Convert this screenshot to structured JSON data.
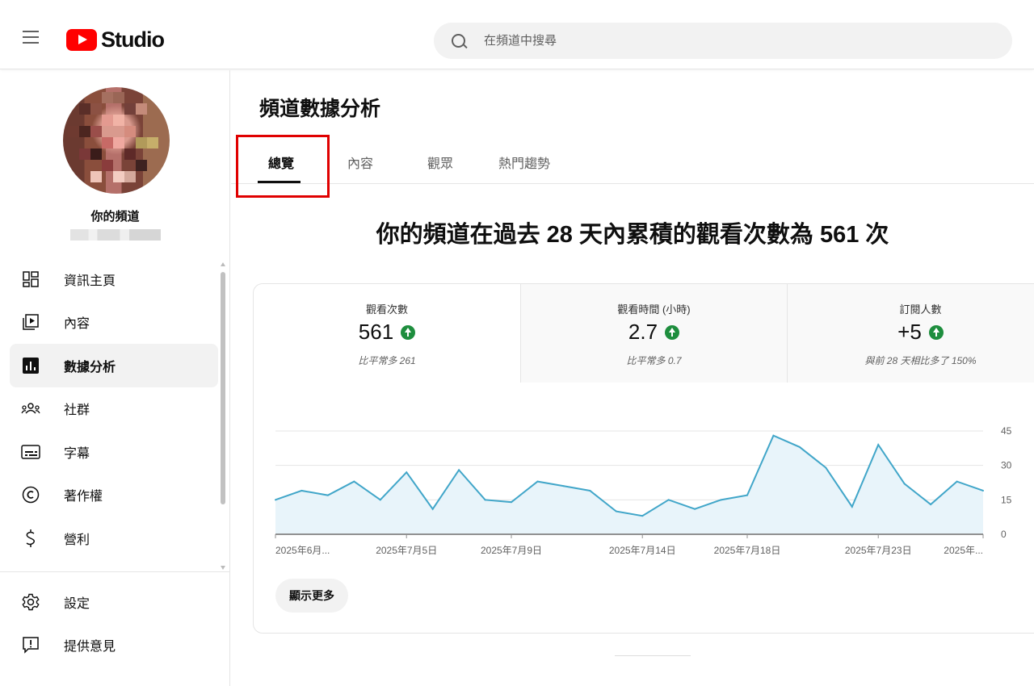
{
  "header": {
    "logo_text": "Studio",
    "search_placeholder": "在頻道中搜尋"
  },
  "sidebar": {
    "channel_name": "你的頻道",
    "items": [
      {
        "label": "資訊主頁",
        "icon": "dashboard-icon"
      },
      {
        "label": "內容",
        "icon": "content-icon"
      },
      {
        "label": "數據分析",
        "icon": "analytics-icon",
        "active": true
      },
      {
        "label": "社群",
        "icon": "community-icon"
      },
      {
        "label": "字幕",
        "icon": "subtitles-icon"
      },
      {
        "label": "著作權",
        "icon": "copyright-icon"
      },
      {
        "label": "營利",
        "icon": "earn-icon"
      }
    ],
    "bottom_items": [
      {
        "label": "設定",
        "icon": "settings-icon"
      },
      {
        "label": "提供意見",
        "icon": "feedback-icon"
      }
    ]
  },
  "main": {
    "title": "頻道數據分析",
    "tabs": [
      {
        "label": "總覽",
        "active": true
      },
      {
        "label": "內容"
      },
      {
        "label": "觀眾"
      },
      {
        "label": "熱門趨勢"
      }
    ],
    "headline": "你的頻道在過去 28 天內累積的觀看次數為 561 次",
    "metrics": [
      {
        "label": "觀看次數",
        "value": "561",
        "sub": "比平常多 261",
        "trend": "up"
      },
      {
        "label": "觀看時間 (小時)",
        "value": "2.7",
        "sub": "比平常多 0.7",
        "trend": "up"
      },
      {
        "label": "訂閱人數",
        "value": "+5",
        "sub": "與前 28 天相比多了 150%",
        "trend": "up"
      }
    ],
    "show_more_label": "顯示更多"
  },
  "colors": {
    "accent_red": "#ff0000",
    "line": "#41a6c9",
    "area": "#e8f4fa",
    "up_green": "#1e8e3e",
    "highlight_box": "#e00000"
  },
  "chart_data": {
    "type": "area",
    "x_tick_labels": [
      "2025年6月...",
      "2025年7月5日",
      "2025年7月9日",
      "2025年7月14日",
      "2025年7月18日",
      "2025年7月23日",
      "2025年..."
    ],
    "y_ticks": [
      "45",
      "30",
      "15",
      "0"
    ],
    "ylim": [
      0,
      45
    ],
    "series": [
      {
        "values": [
          15,
          19,
          17,
          23,
          15,
          27,
          11,
          28,
          15,
          14,
          23,
          21,
          19,
          10,
          8,
          15,
          11,
          15,
          17,
          43,
          38,
          29,
          12,
          39,
          22,
          13,
          23,
          19
        ]
      }
    ]
  }
}
